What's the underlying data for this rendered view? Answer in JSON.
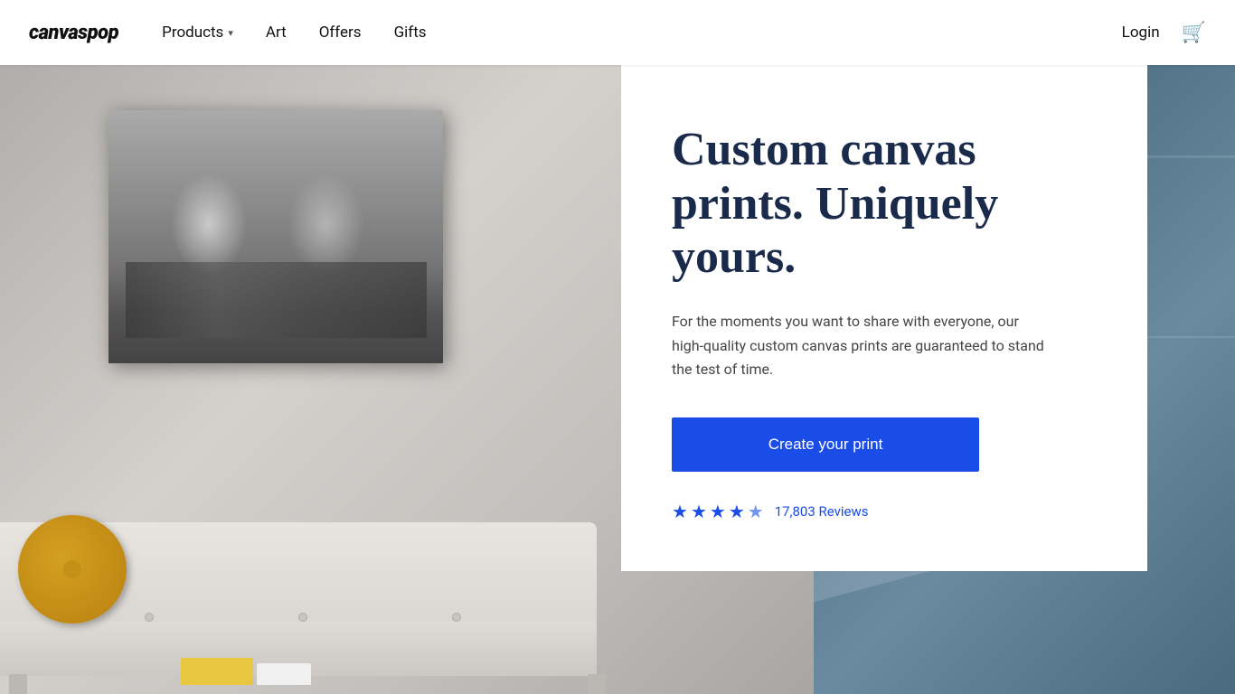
{
  "header": {
    "logo": "canvaspop",
    "nav": [
      {
        "id": "products",
        "label": "Products",
        "hasDropdown": true
      },
      {
        "id": "art",
        "label": "Art",
        "hasDropdown": false
      },
      {
        "id": "offers",
        "label": "Offers",
        "hasDropdown": false
      },
      {
        "id": "gifts",
        "label": "Gifts",
        "hasDropdown": false
      }
    ],
    "login_label": "Login"
  },
  "hero": {
    "title": "Custom canvas prints. Uniquely yours.",
    "description": "For the moments you want to share with everyone, our high-quality custom canvas prints are guaranteed to stand the test of time.",
    "cta_label": "Create your print",
    "reviews": {
      "count": "17,803",
      "label": "17,803 Reviews",
      "stars": 4.5
    }
  },
  "colors": {
    "primary_blue": "#1a4de8",
    "nav_text": "#111111",
    "hero_title": "#1a2a4a",
    "hero_desc": "#444444"
  }
}
